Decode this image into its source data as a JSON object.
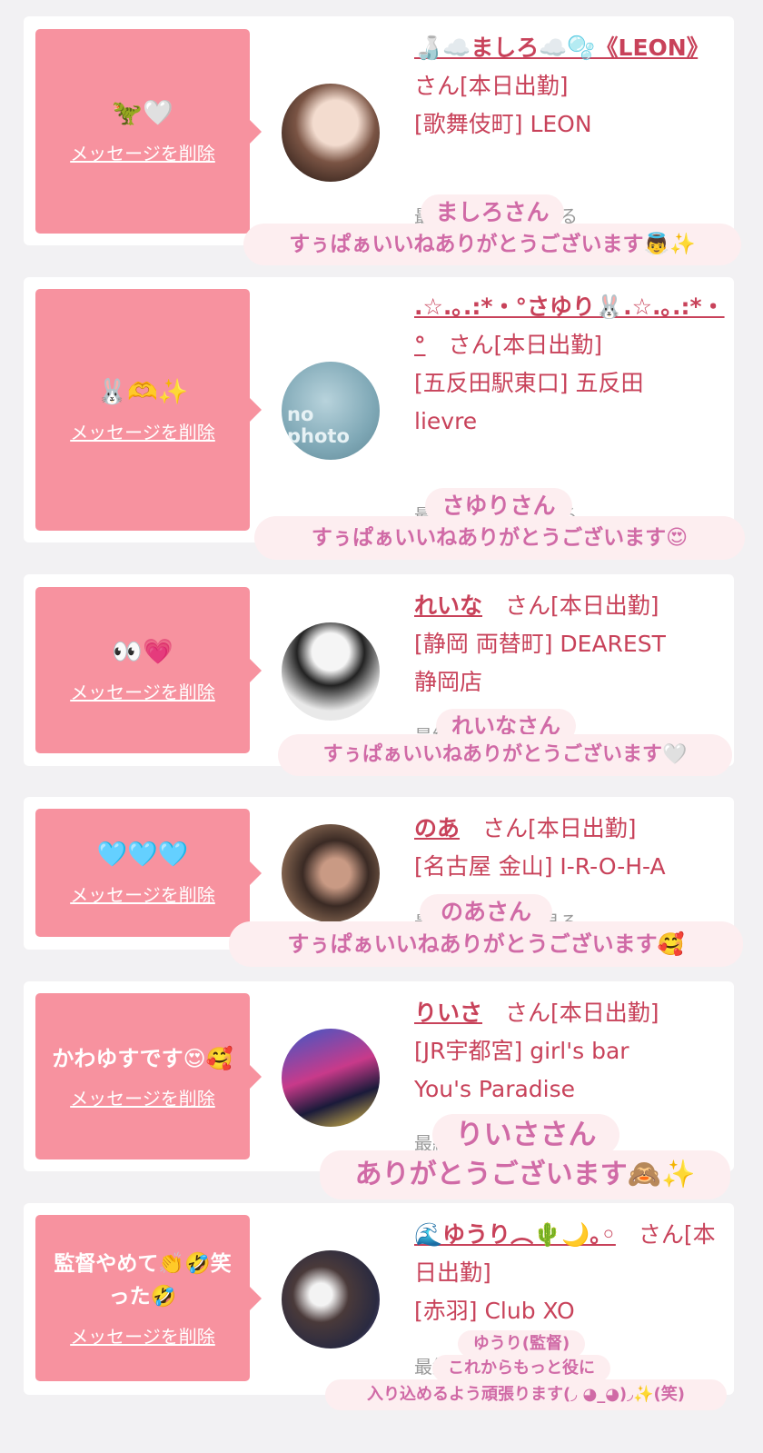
{
  "delete_label": "メッセージを削除",
  "fade_label": "最終ログイン　見る",
  "cards": [
    {
      "bubble": "🦖🤍",
      "name": "🍶☁️ましろ☁️🫧《LEON》",
      "suffix": "　さん[本日出勤]",
      "line2": "[歌舞伎町] LEON",
      "line3": "",
      "overlay_top": "ましろさん",
      "overlay_bottom": "すぅぱぁいいねありがとうございます👼✨"
    },
    {
      "bubble": "🐰🫶✨",
      "name": ".☆.｡.:*・°さゆり🐰.☆.｡.:*・°",
      "suffix": "　さん[本日出勤]",
      "line2": "[五反田駅東口] 五反田",
      "line3": "lievre",
      "avatar_text": "no photo",
      "overlay_top": "さゆりさん",
      "overlay_bottom": "すぅぱぁいいねありがとうございます😍"
    },
    {
      "bubble": "👀💗",
      "name": "れいな",
      "suffix": "　さん[本日出勤]",
      "line2": "[静岡 両替町] DEAREST",
      "line3": "静岡店",
      "overlay_top": "れいなさん",
      "overlay_bottom": "すぅぱぁいいねありがとうございます🤍"
    },
    {
      "bubble": "🩵🩵🩵",
      "name": "のあ",
      "suffix": "　さん[本日出勤]",
      "line2": "[名古屋 金山] I-R-O-H-A",
      "line3": "",
      "overlay_top": "のあさん",
      "overlay_bottom": "すぅぱぁいいねありがとうございます🥰"
    },
    {
      "bubble": "かわゆすです😍🥰",
      "name": "りいさ",
      "suffix": "　さん[本日出勤]",
      "line2": "[JR宇都宮] girl's bar",
      "line3": "You's Paradise",
      "overlay_top": "りいささん",
      "overlay_bottom": "ありがとうございます🙈✨"
    },
    {
      "bubble": "監督やめて👏🤣笑った🤣",
      "name": "🌊ゆうり︵🌵🌙｡◦",
      "suffix": "　さん[本日出勤]",
      "line2": "[赤羽] Club XO",
      "line3": "",
      "overlay_top": "ゆうり(監督)",
      "overlay_mid": "これからもっと役に",
      "overlay_bottom": "入り込めるよう頑張ります(◞ ◕_◕)◞✨(笑)"
    }
  ]
}
